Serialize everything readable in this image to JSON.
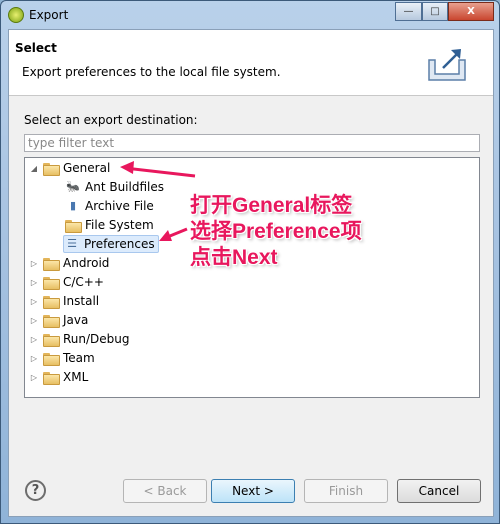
{
  "window": {
    "title": "Export",
    "minimize": "—",
    "maximize": "□",
    "close": "X"
  },
  "header": {
    "title": "Select",
    "description": "Export preferences to the local file system.",
    "icon": "export-icon"
  },
  "destination_label": "Select an export destination:",
  "filter": {
    "placeholder": "type filter text",
    "value": ""
  },
  "tree": [
    {
      "label": "General",
      "expanded": true,
      "icon": "folder-icon",
      "children": [
        {
          "label": "Ant Buildfiles",
          "icon": "ant-icon"
        },
        {
          "label": "Archive File",
          "icon": "archive-icon"
        },
        {
          "label": "File System",
          "icon": "folder-icon"
        },
        {
          "label": "Preferences",
          "icon": "preferences-icon",
          "selected": true
        }
      ]
    },
    {
      "label": "Android",
      "expanded": false
    },
    {
      "label": "C/C++",
      "expanded": false
    },
    {
      "label": "Install",
      "expanded": false
    },
    {
      "label": "Java",
      "expanded": false
    },
    {
      "label": "Run/Debug",
      "expanded": false
    },
    {
      "label": "Team",
      "expanded": false
    },
    {
      "label": "XML",
      "expanded": false
    }
  ],
  "annotation": {
    "lines": [
      "打开General标签",
      "选择Preference项",
      "点击Next"
    ],
    "color": "#e8175d"
  },
  "buttons": {
    "help": "?",
    "back": "< Back",
    "next": "Next >",
    "finish": "Finish",
    "cancel": "Cancel"
  }
}
